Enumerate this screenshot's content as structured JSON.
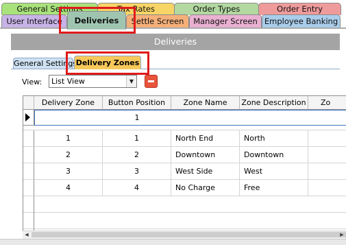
{
  "tabs_row1": [
    {
      "label": "General Settings",
      "color": "#a9e27b"
    },
    {
      "label": "Tax Rates",
      "color": "#f7d466"
    },
    {
      "label": "Order Types",
      "color": "#b3d8a0"
    },
    {
      "label": "Order Entry",
      "color": "#ef9b9b"
    }
  ],
  "tabs_row2": [
    {
      "label": "User Interface",
      "color": "#c8b3e6"
    },
    {
      "label": "Deliveries",
      "color": "#9fc5b0",
      "active": true
    },
    {
      "label": "Settle Screen",
      "color": "#f5b07a"
    },
    {
      "label": "Manager Screen",
      "color": "#eab0d2"
    },
    {
      "label": "Employee Banking",
      "color": "#a9cdea"
    }
  ],
  "section_title": "Deliveries",
  "subtabs": [
    {
      "label": "General Settings",
      "color": "#cfe1f2"
    },
    {
      "label": "Delivery Zones",
      "color": "#f7c85a",
      "active": true
    }
  ],
  "view": {
    "label": "View:",
    "value": "List View"
  },
  "grid": {
    "columns": [
      "Delivery Zone",
      "Button Position",
      "Zone Name",
      "Zone Description",
      "Zo"
    ],
    "new_row_value": "1",
    "rows": [
      [
        "1",
        "1",
        "North End",
        "North"
      ],
      [
        "2",
        "2",
        "Downtown",
        "Downtown"
      ],
      [
        "3",
        "3",
        "West Side",
        "West"
      ],
      [
        "4",
        "4",
        "No Charge",
        "Free"
      ]
    ]
  }
}
